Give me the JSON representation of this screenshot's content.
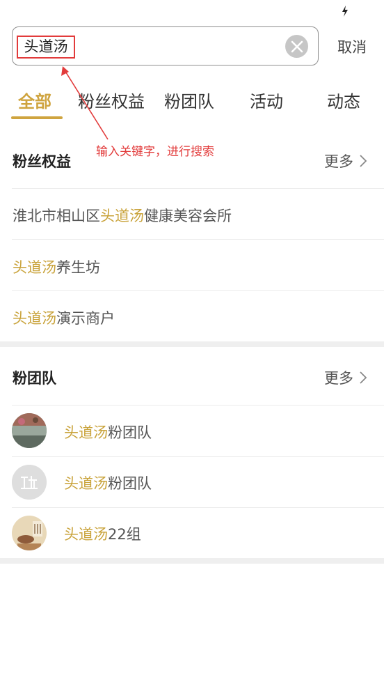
{
  "search": {
    "value": "头道汤",
    "cancel_label": "取消"
  },
  "tabs": [
    {
      "label": "全部",
      "active": true
    },
    {
      "label": "粉丝权益",
      "active": false
    },
    {
      "label": "粉团队",
      "active": false
    },
    {
      "label": "活动",
      "active": false
    },
    {
      "label": "动态",
      "active": false
    }
  ],
  "annotation": {
    "text": "输入关键字，进行搜索",
    "color": "#e23b3b"
  },
  "fan_benefits": {
    "title": "粉丝权益",
    "more_label": "更多",
    "items": [
      {
        "prefix": "淮北市相山区",
        "highlight": "头道汤",
        "suffix": "健康美容会所"
      },
      {
        "prefix": "",
        "highlight": "头道汤",
        "suffix": "养生坊"
      },
      {
        "prefix": "",
        "highlight": "头道汤",
        "suffix": "演示商户"
      }
    ]
  },
  "fan_teams": {
    "title": "粉团队",
    "more_label": "更多",
    "items": [
      {
        "highlight": "头道汤",
        "suffix": "粉团队",
        "avatar": "photo-avatar-icon"
      },
      {
        "highlight": "头道汤",
        "suffix": "粉团队",
        "avatar": "logo-avatar-icon"
      },
      {
        "highlight": "头道汤",
        "suffix": "22组",
        "avatar": "tea-avatar-icon"
      }
    ]
  },
  "colors": {
    "accent": "#cfa43f",
    "highlight": "#c9a33b",
    "annotation": "#e23b3b"
  }
}
